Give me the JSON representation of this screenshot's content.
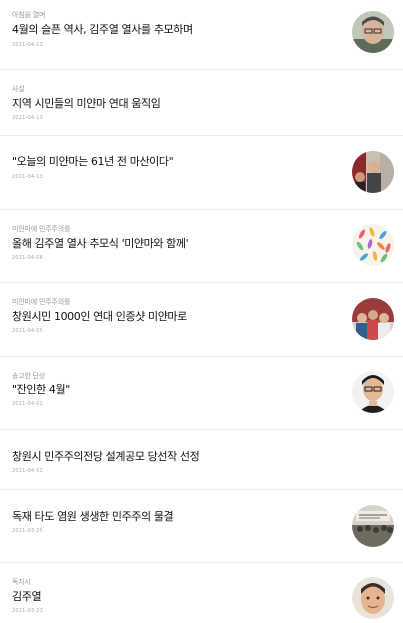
{
  "articles": [
    {
      "category": "아침을 열며",
      "title": "4월의 슬픈 역사, 김주열 열사를 추모하며",
      "date": "2021-04-13",
      "thumb_icon": "person-portrait-icon"
    },
    {
      "category": "사설",
      "title": "지역 시민들의 미얀마 연대 움직임",
      "date": "2021-04-13"
    },
    {
      "category": "",
      "title": "\"오늘의 미얀마는 61년 전 마산이다\"",
      "date": "2021-04-13",
      "thumb_icon": "rally-photo-icon"
    },
    {
      "category": "미얀마에 민주주의를",
      "title": "올해 김주열 열사 추모식 '미얀마와 함께'",
      "date": "2021-04-06",
      "thumb_icon": "petal-art-icon"
    },
    {
      "category": "미얀마에 민주주의를",
      "title": "창원시민 1000인 연대 인증샷 미얀마로",
      "date": "2021-04-05",
      "thumb_icon": "group-photo-icon"
    },
    {
      "category": "송고한 단상",
      "title": "\"잔인한 4월\"",
      "date": "2021-04-02",
      "thumb_icon": "columnist-portrait-icon"
    },
    {
      "category": "",
      "title": "창원시 민주주의전당 설계공모 당선작 선정",
      "date": "2021-04-02"
    },
    {
      "category": "",
      "title": "독재 타도 염원 생생한 민주주의 물결",
      "date": "2021-03-25",
      "thumb_icon": "archive-photo-icon"
    },
    {
      "category": "독자시",
      "title": "김주열",
      "date": "2021-03-23",
      "thumb_icon": "portrait-icon"
    }
  ]
}
